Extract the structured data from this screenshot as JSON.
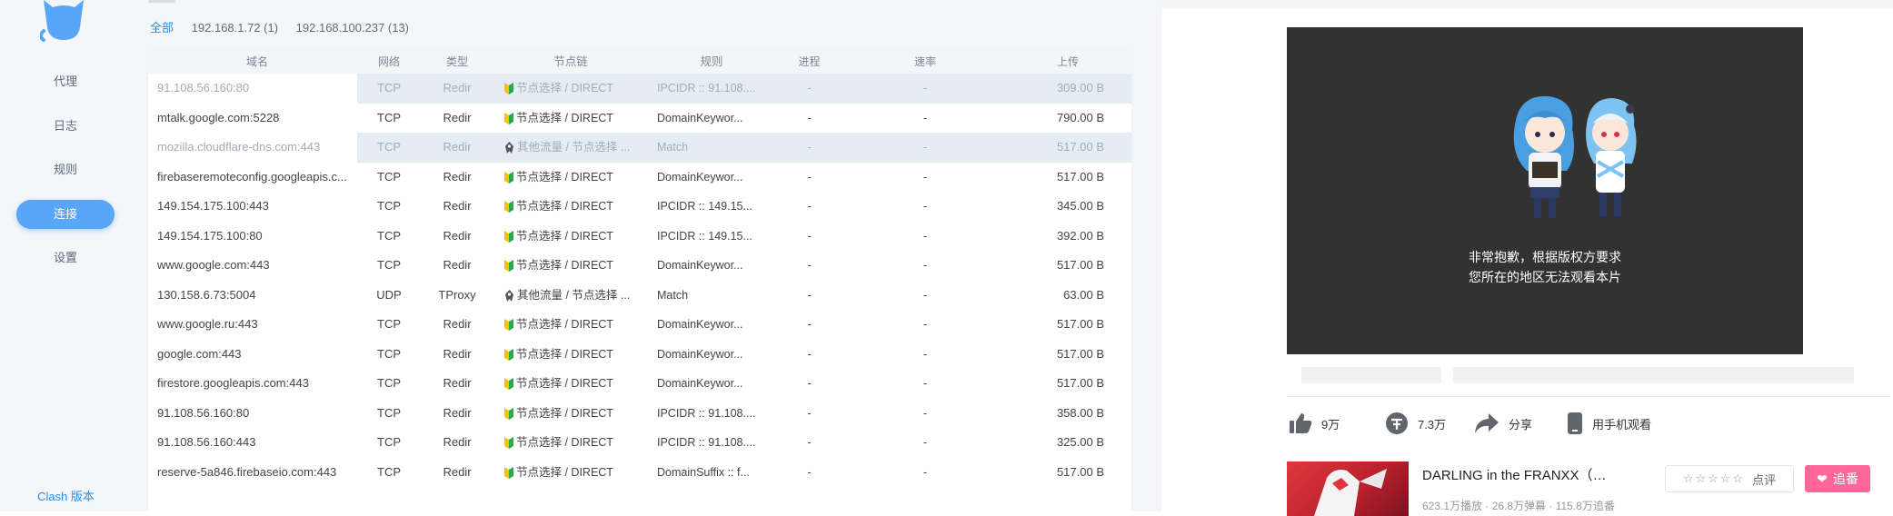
{
  "sidebar": {
    "items": [
      {
        "label": "代理",
        "active": false
      },
      {
        "label": "日志",
        "active": false
      },
      {
        "label": "规则",
        "active": false
      },
      {
        "label": "连接",
        "active": true
      },
      {
        "label": "设置",
        "active": false
      }
    ],
    "version_label": "Clash 版本"
  },
  "filters": {
    "all": "全部",
    "ip1": "192.168.1.72 (1)",
    "ip2": "192.168.100.237 (13)"
  },
  "table": {
    "headers": {
      "host": "域名",
      "network": "网络",
      "type": "类型",
      "chain": "节点链",
      "rule": "规则",
      "process": "进程",
      "speed": "速率",
      "upload": "上传"
    },
    "rows": [
      {
        "host": "91.108.56.160:80",
        "network": "TCP",
        "type": "Redir",
        "chain": "节点选择 / DIRECT",
        "chain_icon": "green-leaf",
        "rule": "IPCIDR :: 91.108....",
        "process": "-",
        "speed": "-",
        "upload": "309.00 B",
        "dim": true,
        "highlight": true
      },
      {
        "host": "mtalk.google.com:5228",
        "network": "TCP",
        "type": "Redir",
        "chain": "节点选择 / DIRECT",
        "chain_icon": "green-leaf",
        "rule": "DomainKeywor...",
        "process": "-",
        "speed": "-",
        "upload": "790.00 B",
        "dim": false,
        "highlight": false
      },
      {
        "host": "mozilla.cloudflare-dns.com:443",
        "network": "TCP",
        "type": "Redir",
        "chain": "其他流量 / 节点选择 ...",
        "chain_icon": "fish",
        "rule": "Match",
        "process": "-",
        "speed": "-",
        "upload": "517.00 B",
        "dim": true,
        "highlight": true
      },
      {
        "host": "firebaseremoteconfig.googleapis.c...",
        "network": "TCP",
        "type": "Redir",
        "chain": "节点选择 / DIRECT",
        "chain_icon": "green-leaf",
        "rule": "DomainKeywor...",
        "process": "-",
        "speed": "-",
        "upload": "517.00 B",
        "dim": false,
        "highlight": false
      },
      {
        "host": "149.154.175.100:443",
        "network": "TCP",
        "type": "Redir",
        "chain": "节点选择 / DIRECT",
        "chain_icon": "green-leaf",
        "rule": "IPCIDR :: 149.15...",
        "process": "-",
        "speed": "-",
        "upload": "345.00 B",
        "dim": false,
        "highlight": false
      },
      {
        "host": "149.154.175.100:80",
        "network": "TCP",
        "type": "Redir",
        "chain": "节点选择 / DIRECT",
        "chain_icon": "green-leaf",
        "rule": "IPCIDR :: 149.15...",
        "process": "-",
        "speed": "-",
        "upload": "392.00 B",
        "dim": false,
        "highlight": false
      },
      {
        "host": "www.google.com:443",
        "network": "TCP",
        "type": "Redir",
        "chain": "节点选择 / DIRECT",
        "chain_icon": "green-leaf",
        "rule": "DomainKeywor...",
        "process": "-",
        "speed": "-",
        "upload": "517.00 B",
        "dim": false,
        "highlight": false
      },
      {
        "host": "130.158.6.73:5004",
        "network": "UDP",
        "type": "TProxy",
        "chain": "其他流量 / 节点选择 ...",
        "chain_icon": "fish",
        "rule": "Match",
        "process": "-",
        "speed": "-",
        "upload": "63.00 B",
        "dim": false,
        "highlight": false
      },
      {
        "host": "www.google.ru:443",
        "network": "TCP",
        "type": "Redir",
        "chain": "节点选择 / DIRECT",
        "chain_icon": "green-leaf",
        "rule": "DomainKeywor...",
        "process": "-",
        "speed": "-",
        "upload": "517.00 B",
        "dim": false,
        "highlight": false
      },
      {
        "host": "google.com:443",
        "network": "TCP",
        "type": "Redir",
        "chain": "节点选择 / DIRECT",
        "chain_icon": "green-leaf",
        "rule": "DomainKeywor...",
        "process": "-",
        "speed": "-",
        "upload": "517.00 B",
        "dim": false,
        "highlight": false
      },
      {
        "host": "firestore.googleapis.com:443",
        "network": "TCP",
        "type": "Redir",
        "chain": "节点选择 / DIRECT",
        "chain_icon": "green-leaf",
        "rule": "DomainKeywor...",
        "process": "-",
        "speed": "-",
        "upload": "517.00 B",
        "dim": false,
        "highlight": false
      },
      {
        "host": "91.108.56.160:80",
        "network": "TCP",
        "type": "Redir",
        "chain": "节点选择 / DIRECT",
        "chain_icon": "green-leaf",
        "rule": "IPCIDR :: 91.108....",
        "process": "-",
        "speed": "-",
        "upload": "358.00 B",
        "dim": false,
        "highlight": false
      },
      {
        "host": "91.108.56.160:443",
        "network": "TCP",
        "type": "Redir",
        "chain": "节点选择 / DIRECT",
        "chain_icon": "green-leaf",
        "rule": "IPCIDR :: 91.108....",
        "process": "-",
        "speed": "-",
        "upload": "325.00 B",
        "dim": false,
        "highlight": false
      },
      {
        "host": "reserve-5a846.firebaseio.com:443",
        "network": "TCP",
        "type": "Redir",
        "chain": "节点选择 / DIRECT",
        "chain_icon": "green-leaf",
        "rule": "DomainSuffix :: f...",
        "process": "-",
        "speed": "-",
        "upload": "517.00 B",
        "dim": false,
        "highlight": false
      }
    ]
  },
  "video": {
    "message_line1": "非常抱歉，根据版权方要求",
    "message_line2": "您所在的地区无法观看本片",
    "actions": {
      "like": "9万",
      "coin": "7.3万",
      "share": "分享",
      "phone": "用手机观看"
    },
    "anime": {
      "title": "DARLING in the FRANXX（僵限...",
      "stats": "623.1万播放 · 26.8万弹幕 · 115.8万追番",
      "rate_label": "点评",
      "follow_label": "追番"
    },
    "colors": {
      "accent": "#ff6699",
      "player_bg": "#323232"
    }
  },
  "colors": {
    "clash_accent": "#57a6f7",
    "link": "#2e8be8"
  }
}
